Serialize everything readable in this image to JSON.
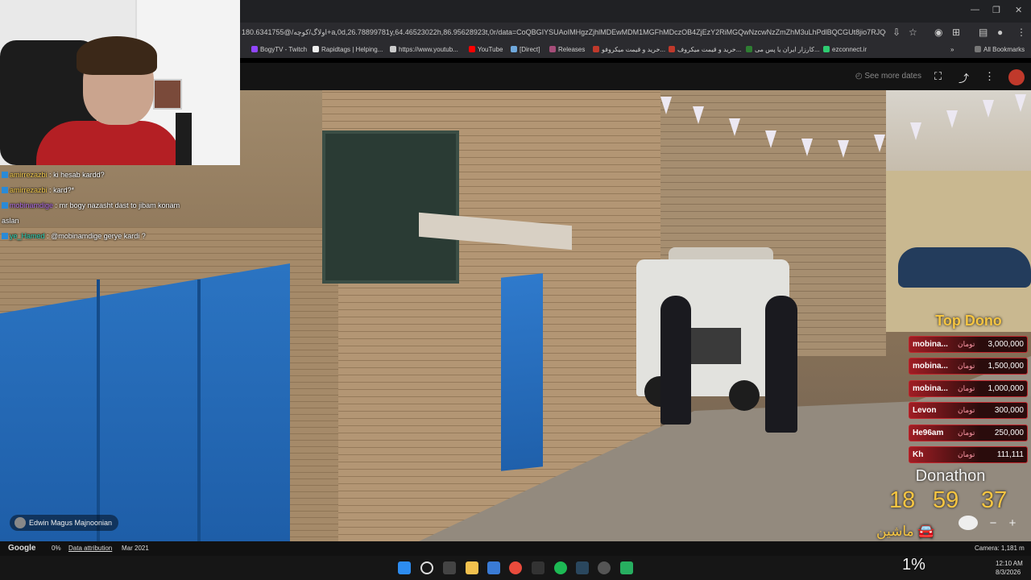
{
  "browser": {
    "url": "180.6341755@/اولاگ/کوچه+a,0d,26.78899781y,64.46523022h,86.95628923t,0r/data=CoQBGIYSUAoIMHgzZjhlMDEwMDM1MGFhMDczOB4ZjEzY2RiMGQwNzcwNzZmZhM3uLhPdlBQCGUt8jio7RJQCoV2qnZ...",
    "bookmarks": [
      {
        "label": "BogyTV - Twitch",
        "color": "#9146ff"
      },
      {
        "label": "Rapidtags | Helping...",
        "color": "#ffffff"
      },
      {
        "label": "https://www.youtub...",
        "color": "#cccccc"
      },
      {
        "label": "YouTube",
        "color": "#ff0000"
      },
      {
        "label": "[Direct]",
        "color": "#6fa8dc"
      },
      {
        "label": "Releases",
        "color": "#a64d79"
      },
      {
        "label": "خرید و قیمت میکروفو...",
        "color": "#c0392b"
      },
      {
        "label": "خرید و قیمت میکروف...",
        "color": "#c0392b"
      },
      {
        "label": "کارزار ایران یا پس می...",
        "color": "#2e7d32"
      },
      {
        "label": "ezconnect.ir",
        "color": "#2ecc71"
      }
    ],
    "all_bookmarks": "All Bookmarks"
  },
  "map_top": {
    "see_more": "See more dates"
  },
  "chat": [
    {
      "user": "amirrezazbi",
      "user_class": "u1",
      "sep": ":",
      "msg": "ki hesab kardd?"
    },
    {
      "user": "amirrezazbi",
      "user_class": "u1",
      "sep": ":",
      "msg": "kard?*"
    },
    {
      "user": "mobinamdige",
      "user_class": "u2",
      "sep": ":",
      "msg": "mr bogy nazasht dast to jibam konam"
    },
    {
      "user": "",
      "user_class": "",
      "sep": "",
      "msg": "aslan"
    },
    {
      "user": "ye_Hamed",
      "user_class": "u3",
      "sep": ":",
      "msg": "@mobinamdige gerye kardi ?"
    }
  ],
  "attribution_name": "Edwin Magus Majnoonian",
  "donations": {
    "title": "Top Dono",
    "currency": "تومان",
    "rows": [
      {
        "name": "mobina...",
        "amount": "3,000,000"
      },
      {
        "name": "mobina...",
        "amount": "1,500,000"
      },
      {
        "name": "mobina...",
        "amount": "1,000,000"
      },
      {
        "name": "Levon",
        "amount": "300,000"
      },
      {
        "name": "He96am",
        "amount": "250,000"
      },
      {
        "name": "Kh",
        "amount": "111,111"
      }
    ]
  },
  "donathon": {
    "title": "Donathon",
    "hours": "18",
    "minutes": "59",
    "seconds": "37",
    "label": "ماشین"
  },
  "map_footer": {
    "brand": "Google",
    "percent": "0%",
    "data_attribution": "Data attribution",
    "date": "Mar 2021",
    "camera": "Camera: 1,181 m"
  },
  "overlay_percent": "1%",
  "taskbar": {
    "time": "12:10 AM",
    "date": "8/3/2026"
  }
}
